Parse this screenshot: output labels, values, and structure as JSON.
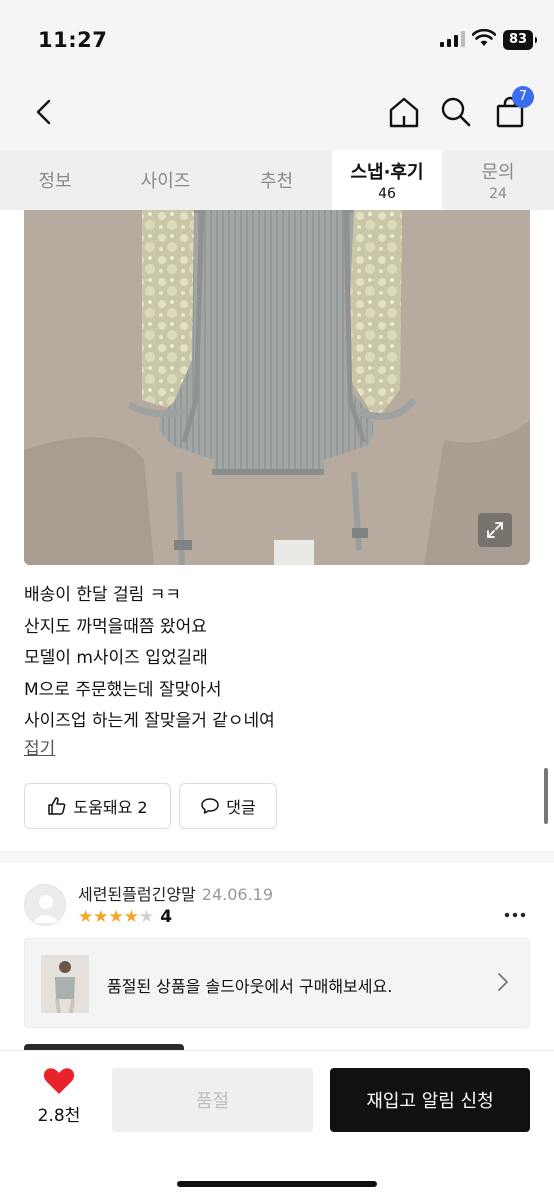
{
  "status_bar": {
    "time": "11:27",
    "battery": "83"
  },
  "nav": {
    "cart_count": "7"
  },
  "tabs": [
    {
      "label": "정보",
      "count": ""
    },
    {
      "label": "사이즈",
      "count": ""
    },
    {
      "label": "추천",
      "count": ""
    },
    {
      "label": "스냅·후기",
      "count": "46"
    },
    {
      "label": "문의",
      "count": "24"
    }
  ],
  "review": {
    "lines": [
      "배송이 한달 걸림 ㅋㅋ",
      "산지도 까먹을때쯤 왔어요",
      "모델이 m사이즈 입었길래",
      "M으로 주문했는데 잘맞아서",
      "사이즈업 하는게 잘맞을거 같ㅇ네여"
    ],
    "fold_label": "접기",
    "helpful_label": "도움돼요 2",
    "comment_label": "댓글"
  },
  "next_review": {
    "name": "세련된플럼긴양말",
    "date": "24.06.19",
    "rating": 4,
    "rating_label": "4",
    "soldout_banner": "품절된 상품을 솔드아웃에서 구매해보세요."
  },
  "bottom_bar": {
    "like_count": "2.8천",
    "soldout_label": "품절",
    "restock_label": "재입고 알림 신청"
  },
  "colors": {
    "accent_blue": "#3b6df0",
    "heart_red": "#e8232a",
    "star_gold": "#f5a623"
  }
}
